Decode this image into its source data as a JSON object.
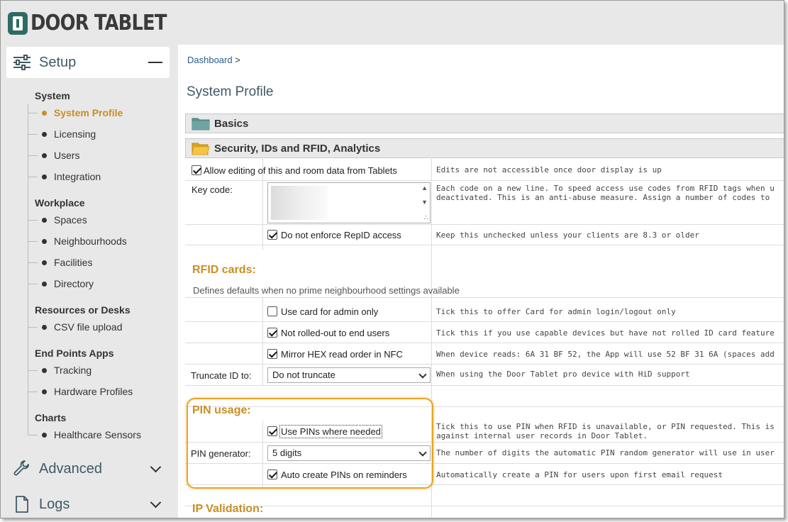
{
  "app": {
    "logo_text": "DOOR TABLET"
  },
  "sidebar": {
    "setup": {
      "label": "Setup"
    },
    "advanced": {
      "label": "Advanced"
    },
    "logs": {
      "label": "Logs"
    },
    "groups": {
      "system": "System",
      "workplace": "Workplace",
      "resources": "Resources or Desks",
      "endpoints": "End Points Apps",
      "charts": "Charts"
    },
    "items": {
      "system_profile": "System Profile",
      "licensing": "Licensing",
      "users": "Users",
      "integration": "Integration",
      "spaces": "Spaces",
      "neighbourhoods": "Neighbourhoods",
      "facilities": "Facilities",
      "directory": "Directory",
      "csv_upload": "CSV file upload",
      "tracking": "Tracking",
      "hardware_profiles": "Hardware Profiles",
      "healthcare_sensors": "Healthcare Sensors"
    }
  },
  "main": {
    "breadcrumb": {
      "link": "Dashboard",
      "separator": ">"
    },
    "page_title": "System Profile",
    "panels": {
      "basics": "Basics",
      "security": "Security, IDs and RFID, Analytics"
    },
    "rows": {
      "allow_editing": {
        "label": "Allow editing of this and room data from Tablets",
        "checked": true,
        "help": "Edits are not accessible once door display is up"
      },
      "key_code": {
        "label": "Key code:",
        "help1": "Each code on a new line. To speed access use codes from RFID tags when u",
        "help2": "deactivated. This is an anti-abuse measure. Assign a number of codes to"
      },
      "repid": {
        "label": "Do not enforce RepID access",
        "checked": true,
        "help": "Keep this unchecked unless your clients are 8.3 or older"
      }
    },
    "rfid": {
      "title": "RFID cards:",
      "subtitle": "Defines defaults when no prime neighbourhood settings available",
      "use_card_admin": {
        "label": "Use card for admin only",
        "checked": false,
        "help": "Tick this to offer Card for admin login/logout only"
      },
      "not_rolled": {
        "label": "Not rolled-out to end users",
        "checked": true,
        "help": "Tick this if you use capable devices but have not rolled ID card feature"
      },
      "mirror_hex": {
        "label": "Mirror HEX read order in NFC",
        "checked": true,
        "help": "When device reads: 6A 31 BF 52, the App will use 52 BF 31 6A (spaces add"
      },
      "truncate": {
        "label": "Truncate ID to:",
        "value": "Do not truncate",
        "help": "When using the Door Tablet pro device with HiD support"
      }
    },
    "pin": {
      "title": "PIN usage:",
      "use_pins": {
        "label": "Use PINs where needed",
        "checked": true,
        "help1": "Tick this to use PIN when RFID is unavailable, or PIN requested. This is",
        "help2": "against internal user records in Door Tablet."
      },
      "generator": {
        "label": "PIN generator:",
        "value": "5 digits",
        "help": "The number of digits the automatic PIN random generator will use in user"
      },
      "auto_create": {
        "label": "Auto create PINs on reminders",
        "checked": true,
        "help": "Automatically create a PIN for users upon first email request"
      }
    },
    "ip": {
      "title": "IP Validation:"
    }
  },
  "colors": {
    "accent": "#c98f22",
    "highlight": "#e8a425",
    "nav_text": "#3f5a66",
    "link": "#2a5d8c",
    "logo": "#2f6b63"
  }
}
